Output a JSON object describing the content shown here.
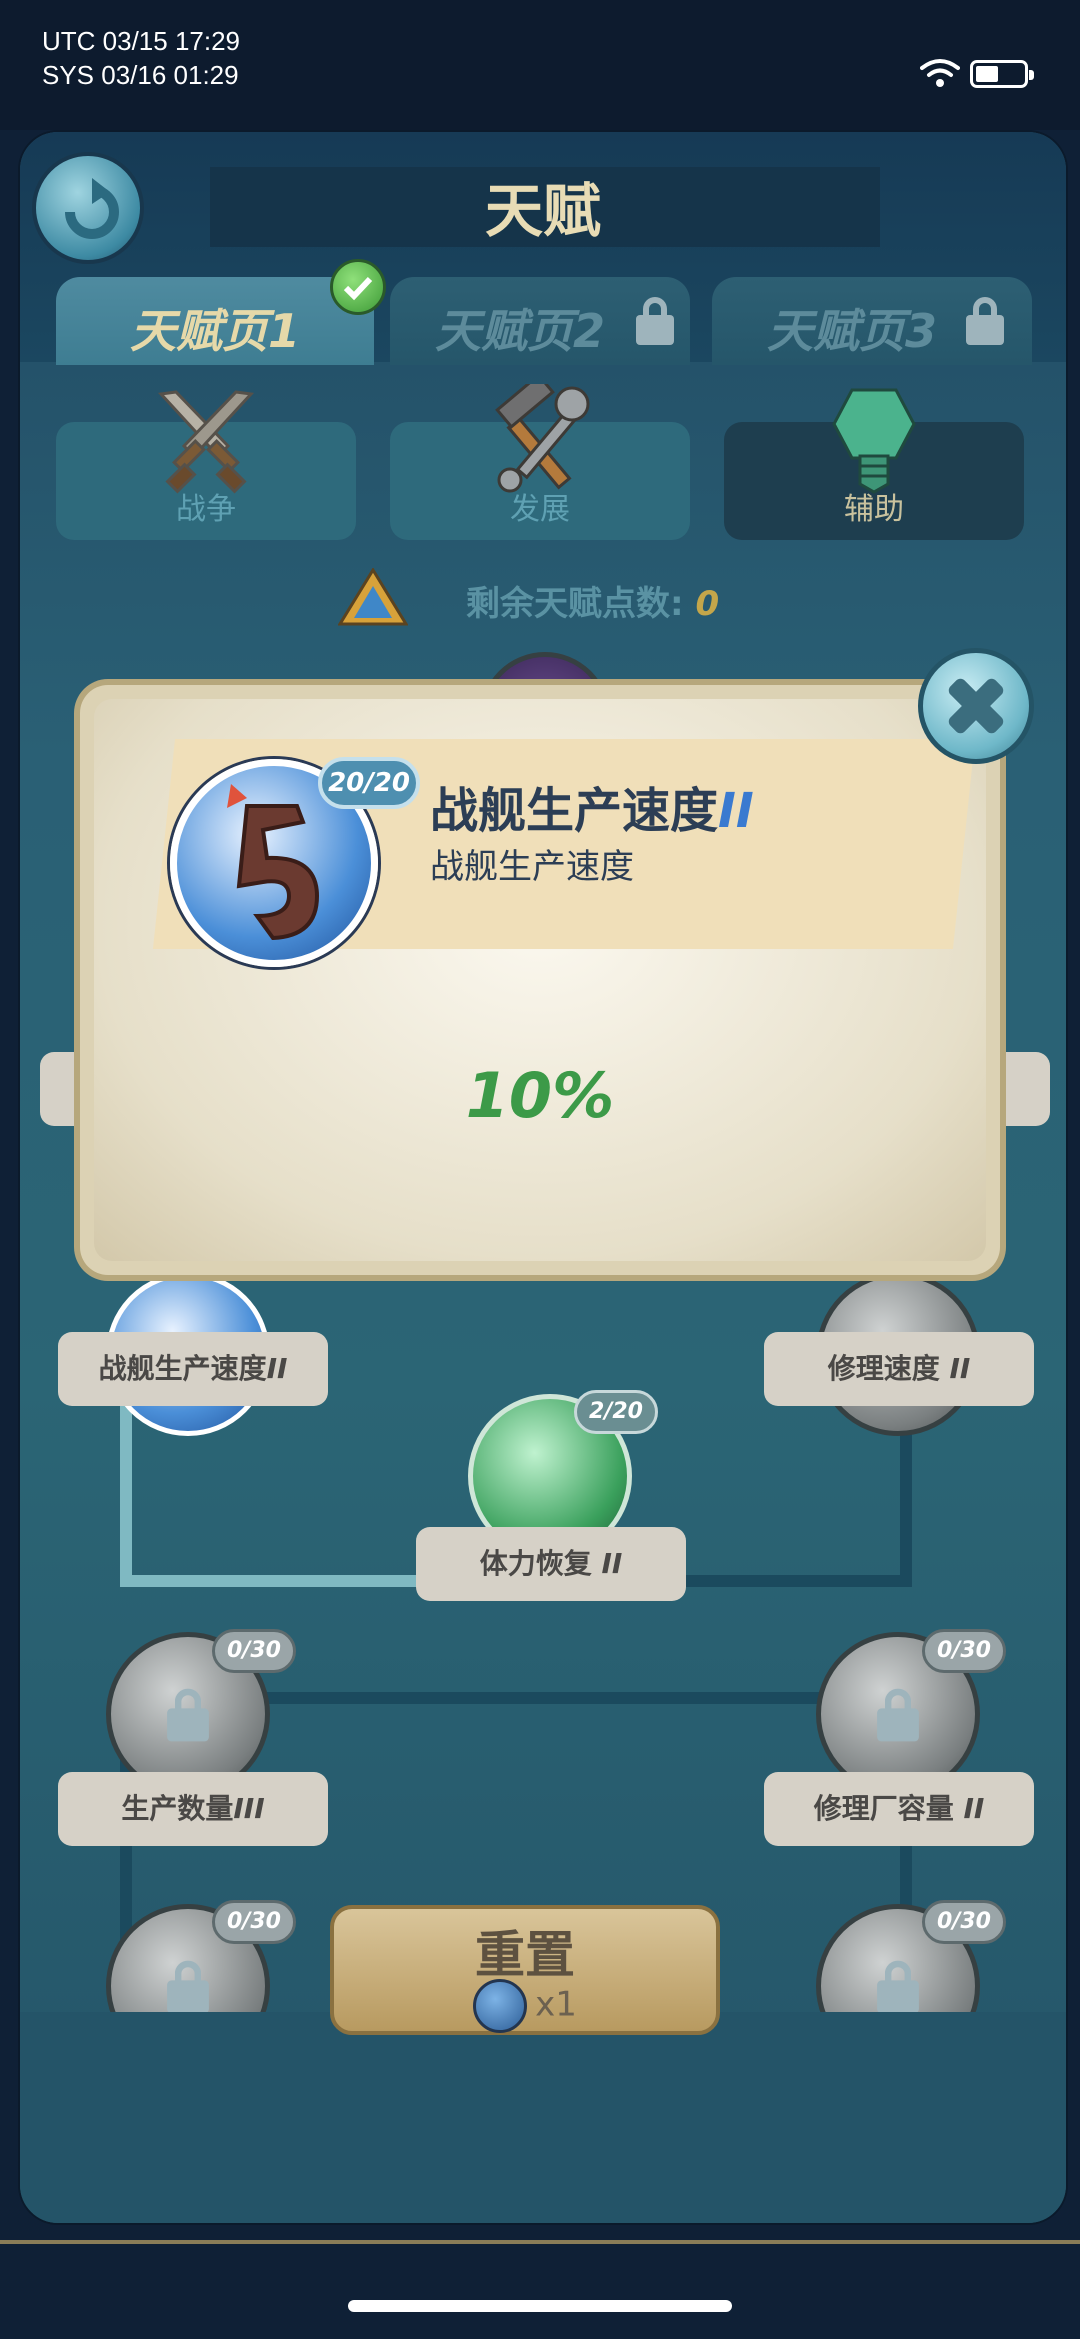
{
  "status_bar": {
    "utc": "UTC 03/15 17:29",
    "sys": "SYS 03/16 01:29"
  },
  "header": {
    "title": "天赋"
  },
  "tabs": [
    {
      "label": "天赋页",
      "num": "1",
      "state": "active"
    },
    {
      "label": "天赋页",
      "num": "2",
      "state": "locked"
    },
    {
      "label": "天赋页",
      "num": "3",
      "state": "locked"
    }
  ],
  "categories": [
    {
      "label": "战争",
      "icon": "crossed-swords-icon"
    },
    {
      "label": "发展",
      "icon": "hammer-wrench-icon"
    },
    {
      "label": "辅助",
      "icon": "bolt-icon"
    }
  ],
  "points": {
    "label": "剩余天赋点数:",
    "value": "0"
  },
  "tree": {
    "nodes": [
      {
        "label": "战舰生产速度",
        "rank": "II",
        "badge": ""
      },
      {
        "label": "修理速度",
        "rank": "II",
        "badge": ""
      },
      {
        "label": "体力恢复",
        "rank": "II",
        "badge": "2/20"
      },
      {
        "label": "生产数量",
        "rank": "III",
        "badge": "0/30"
      },
      {
        "label": "修理厂容量",
        "rank": "II",
        "badge": "0/30"
      },
      {
        "label": "",
        "rank": "",
        "badge": "0/30"
      },
      {
        "label": "",
        "rank": "",
        "badge": "0/30"
      }
    ]
  },
  "reset": {
    "label": "重置",
    "cost": "x1"
  },
  "modal": {
    "badge": "20/20",
    "name": "战舰生产速度",
    "rank": "II",
    "description": "战舰生产速度",
    "value": "10%"
  },
  "colors": {
    "accent_green": "#3c9a48",
    "gold": "#c4a64a",
    "panel_teal": "#2b6575"
  }
}
